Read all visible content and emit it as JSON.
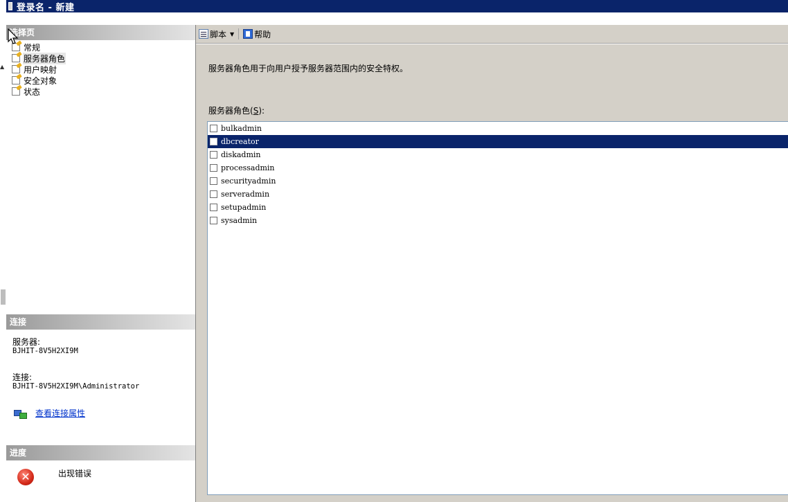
{
  "window": {
    "title": "登录名 - 新建"
  },
  "left_pane": {
    "select_page_header": "选择页",
    "nav_items": [
      {
        "label": "常规",
        "selected": false
      },
      {
        "label": "服务器角色",
        "selected": true
      },
      {
        "label": "用户映射",
        "selected": false
      },
      {
        "label": "安全对象",
        "selected": false
      },
      {
        "label": "状态",
        "selected": false
      }
    ],
    "connection": {
      "header": "连接",
      "server_label": "服务器:",
      "server_value": "BJHIT-8V5H2XI9M",
      "connection_label": "连接:",
      "connection_value": "BJHIT-8V5H2XI9M\\Administrator",
      "view_properties_link": "查看连接属性"
    },
    "progress": {
      "header": "进度",
      "status_text": "出现错误"
    }
  },
  "toolbar": {
    "script_label": "脚本",
    "help_label": "帮助"
  },
  "main": {
    "description": "服务器角色用于向用户授予服务器范围内的安全特权。",
    "roles_label": "服务器角色",
    "roles_label_accel": "S",
    "roles": [
      {
        "name": "bulkadmin",
        "checked": false,
        "selected": false
      },
      {
        "name": "dbcreator",
        "checked": false,
        "selected": true
      },
      {
        "name": "diskadmin",
        "checked": false,
        "selected": false
      },
      {
        "name": "processadmin",
        "checked": false,
        "selected": false
      },
      {
        "name": "securityadmin",
        "checked": false,
        "selected": false
      },
      {
        "name": "serveradmin",
        "checked": false,
        "selected": false
      },
      {
        "name": "setupadmin",
        "checked": false,
        "selected": false
      },
      {
        "name": "sysadmin",
        "checked": false,
        "selected": false
      }
    ]
  },
  "colors": {
    "titlebar": "#0a246a",
    "selection": "#0a246a",
    "link": "#0033cc",
    "error": "#d42a1a"
  },
  "icons": {
    "page": "page-settings-icon",
    "script": "script-icon",
    "help": "help-icon",
    "connection": "connection-properties-icon",
    "error": "error-icon"
  }
}
